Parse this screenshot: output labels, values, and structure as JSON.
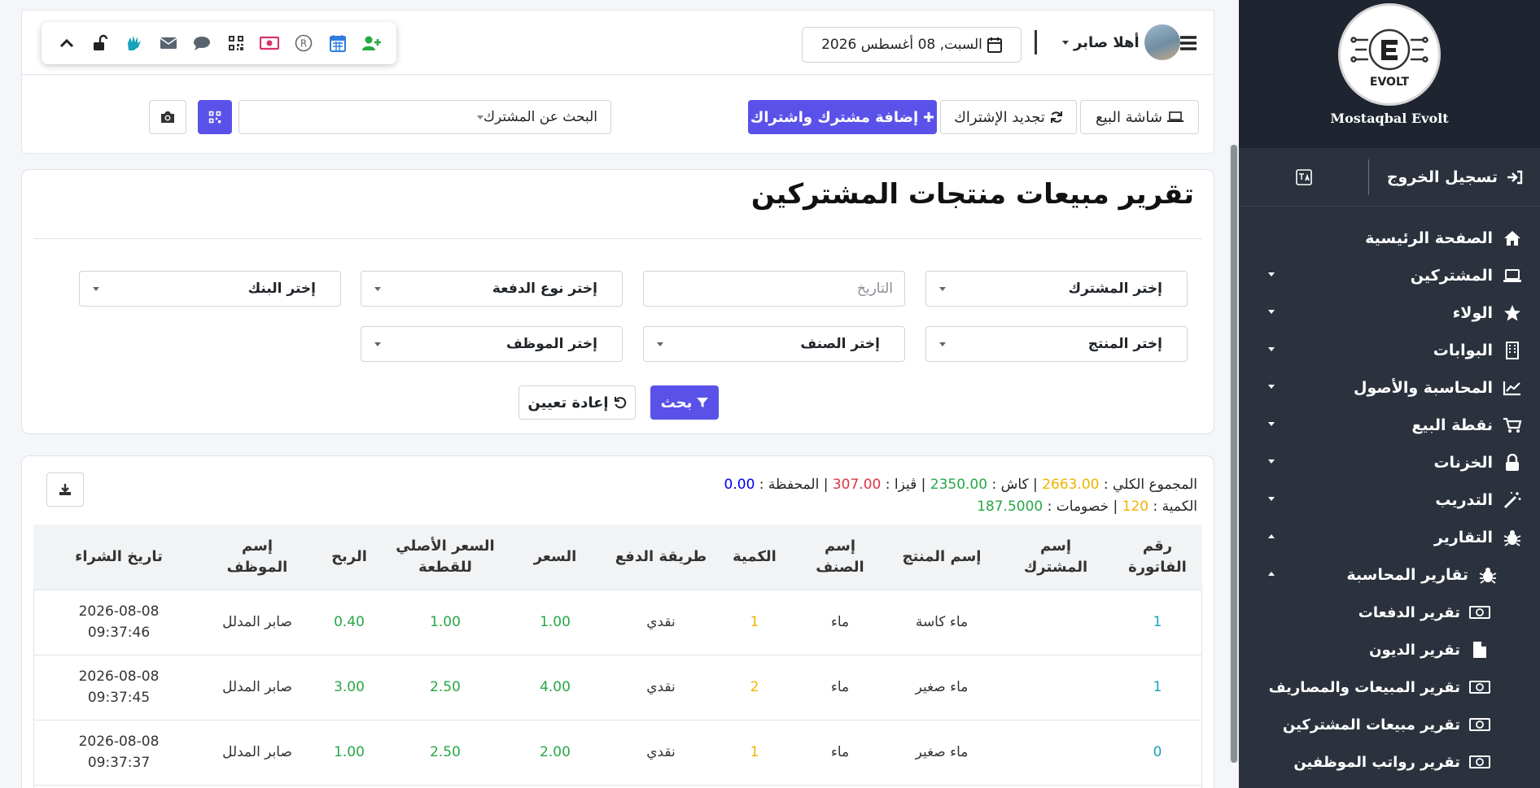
{
  "brand": {
    "name": "Mostaqbal Evolt",
    "logo_text": "EVOLT"
  },
  "sidebar": {
    "logout_label": "تسجيل الخروج",
    "items": [
      {
        "label": "الصفحة الرئيسية",
        "icon": "home-icon"
      },
      {
        "label": "المشتركين",
        "icon": "laptop-icon"
      },
      {
        "label": "الولاء",
        "icon": "star-icon"
      },
      {
        "label": "البوابات",
        "icon": "building-icon"
      },
      {
        "label": "المحاسبة والأصول",
        "icon": "chart-line-icon"
      },
      {
        "label": "نقطة البيع",
        "icon": "cart-icon"
      },
      {
        "label": "الخزنات",
        "icon": "lock-icon"
      },
      {
        "label": "التدريب",
        "icon": "magic-wand-icon"
      },
      {
        "label": "التقارير",
        "icon": "bug-icon"
      },
      {
        "label": "تقارير المحاسبة",
        "icon": "bug-icon"
      },
      {
        "label": "تقرير الدفعات",
        "icon": "money-icon"
      },
      {
        "label": "تقرير الديون",
        "icon": "file-icon"
      },
      {
        "label": "تقرير المبيعات والمصاريف",
        "icon": "money-icon"
      },
      {
        "label": "تقرير مبيعات المشتركين",
        "icon": "money-icon"
      },
      {
        "label": "تقرير رواتب الموظفين",
        "icon": "money-icon"
      }
    ]
  },
  "header": {
    "date": "السبت, 08 أغسطس 2026",
    "greeting": "أهلا صابر"
  },
  "actions": {
    "pos_screen": "شاشة البيع",
    "renew": "تجديد الإشتراك",
    "add_subscriber": "إضافة مشترك واشتراك",
    "search_placeholder": "البحث عن المشترك"
  },
  "filters": {
    "title": "تقرير مبيعات منتجات المشتركين",
    "subscriber": "إختر المشترك",
    "date_placeholder": "التاريخ",
    "payment_type": "إختر نوع الدفعة",
    "bank": "إختر البنك",
    "product": "إختر المنتج",
    "category": "إختر الصنف",
    "employee": "إختر الموظف",
    "search_btn": "بحث",
    "reset_btn": "إعادة تعيين"
  },
  "summary": {
    "total_label": "المجموع الكلي :",
    "total_value": "2663.00",
    "cash_label": "| كاش :",
    "cash_value": "2350.00",
    "visa_label": "| ڤيزا :",
    "visa_value": "307.00",
    "wallet_label": "| المحفظة :",
    "wallet_value": "0.00",
    "qty_label": "الكمية :",
    "qty_value": "120",
    "discount_label": "| خصومات :",
    "discount_value": "187.5000"
  },
  "table": {
    "headers": [
      [
        "رقم",
        "الفاتورة"
      ],
      [
        "إسم",
        "المشترك"
      ],
      [
        "إسم المنتج",
        ""
      ],
      [
        "إسم",
        "الصنف"
      ],
      [
        "الكمية",
        ""
      ],
      [
        "طريقة الدفع",
        ""
      ],
      [
        "السعر",
        ""
      ],
      [
        "السعر الأصلي",
        "للقطعة"
      ],
      [
        "الربح",
        ""
      ],
      [
        "إسم",
        "الموظف"
      ],
      [
        "تاريخ الشراء",
        ""
      ]
    ],
    "rows": [
      {
        "invoice": "1",
        "subscriber": "",
        "product": "ماء كاسة",
        "category": "ماء",
        "qty": "1",
        "payment": "نقدي",
        "price": "1.00",
        "orig_price": "1.00",
        "profit": "0.40",
        "employee": "صابر المدلل",
        "date": "2026-08-08",
        "time": "09:37:46"
      },
      {
        "invoice": "1",
        "subscriber": "",
        "product": "ماء صغير",
        "category": "ماء",
        "qty": "2",
        "payment": "نقدي",
        "price": "4.00",
        "orig_price": "2.50",
        "profit": "3.00",
        "employee": "صابر المدلل",
        "date": "2026-08-08",
        "time": "09:37:45"
      },
      {
        "invoice": "0",
        "subscriber": "",
        "product": "ماء صغير",
        "category": "ماء",
        "qty": "1",
        "payment": "نقدي",
        "price": "2.00",
        "orig_price": "2.50",
        "profit": "1.00",
        "employee": "صابر المدلل",
        "date": "2026-08-08",
        "time": "09:37:37"
      }
    ]
  },
  "colors": {
    "primary": "#5a52e8",
    "sidebar": "#2b323d",
    "green": "#28a745",
    "yellow": "#f0b400",
    "red": "#dc3545",
    "teal": "#17a2b8"
  }
}
